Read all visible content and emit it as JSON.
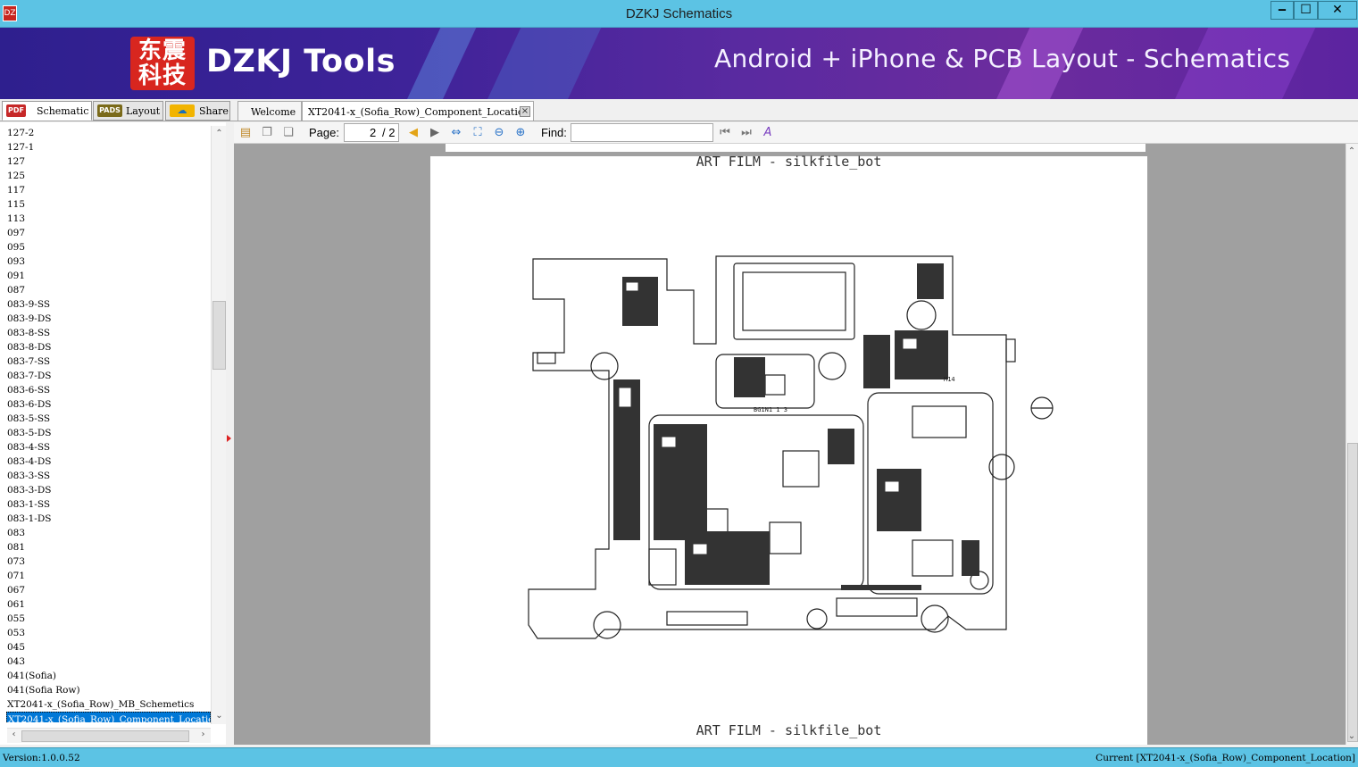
{
  "window": {
    "title": "DZKJ Schematics",
    "app_icon_label": "DZ"
  },
  "window_controls": {
    "minimize": "‒",
    "maximize": "☐",
    "close": "✕"
  },
  "banner": {
    "logo_chars_line1": "东震",
    "logo_chars_line2": "科技",
    "brand": "DZKJ Tools",
    "tagline": "Android + iPhone & PCB Layout - Schematics"
  },
  "left_tabs": [
    {
      "label": "Schematic",
      "badge": "PDF",
      "badge_color": "#c62828"
    },
    {
      "label": "Layout",
      "badge": "PADS",
      "badge_color": "#7a6a1a"
    },
    {
      "label": "Share",
      "badge": "☁",
      "badge_color": "#2e8bd8"
    }
  ],
  "doc_tabs": [
    {
      "label": "Welcome"
    },
    {
      "label": "XT2041-x_(Sofia_Row)_Component_Location",
      "close": "×"
    }
  ],
  "file_list": [
    "127-2",
    "127-1",
    "127",
    "125",
    "117",
    "115",
    "113",
    "097",
    "095",
    "093",
    "091",
    "087",
    "083-9-SS",
    "083-9-DS",
    "083-8-SS",
    "083-8-DS",
    "083-7-SS",
    "083-7-DS",
    "083-6-SS",
    "083-6-DS",
    "083-5-SS",
    "083-5-DS",
    "083-4-SS",
    "083-4-DS",
    "083-3-SS",
    "083-3-DS",
    "083-1-SS",
    "083-1-DS",
    "083",
    "081",
    "073",
    "071",
    "067",
    "061",
    "055",
    "053",
    "045",
    "043",
    "041(Sofia)",
    "041(Sofia Row)",
    "XT2041-x_(Sofia_Row)_MB_Schemetics"
  ],
  "selected_file": "XT2041-x_(Sofia_Row)_Component_Location",
  "toolbar": {
    "page_label": "Page:",
    "page_current": "2",
    "page_total": "/ 2",
    "find_label": "Find:",
    "find_value": ""
  },
  "document": {
    "header": "ART FILM - silkfile_bot",
    "footer": "ART FILM - silkfile_bot",
    "board_labels": [
      "M14",
      "BG1N1 1 3"
    ]
  },
  "status": {
    "version": "Version:1.0.0.52",
    "current": "Current [XT2041-x_(Sofia_Row)_Component_Location]"
  },
  "colors": {
    "titlebar": "#5cc3e4",
    "selection": "#0078d7",
    "viewer_bg": "#a0a0a0"
  }
}
